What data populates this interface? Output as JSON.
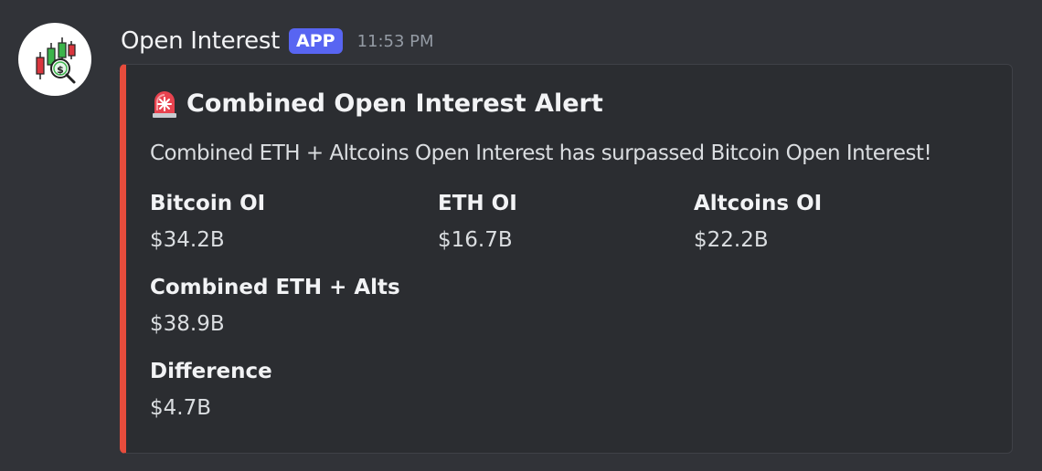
{
  "message": {
    "username": "Open Interest",
    "badge": "APP",
    "timestamp": "11:53 PM",
    "avatar_icon": "candlestick-chart-magnifier-icon"
  },
  "embed": {
    "accent_color": "#e74c3c",
    "title_icon": "police-siren-icon",
    "title": "Combined Open Interest Alert",
    "description": "Combined ETH + Altcoins Open Interest has surpassed Bitcoin Open Interest!",
    "fields": [
      {
        "name": "Bitcoin OI",
        "value": "$34.2B"
      },
      {
        "name": "ETH OI",
        "value": "$16.7B"
      },
      {
        "name": "Altcoins OI",
        "value": "$22.2B"
      },
      {
        "name": "Combined ETH + Alts",
        "value": "$38.9B"
      },
      {
        "name": "Difference",
        "value": "$4.7B"
      }
    ]
  }
}
